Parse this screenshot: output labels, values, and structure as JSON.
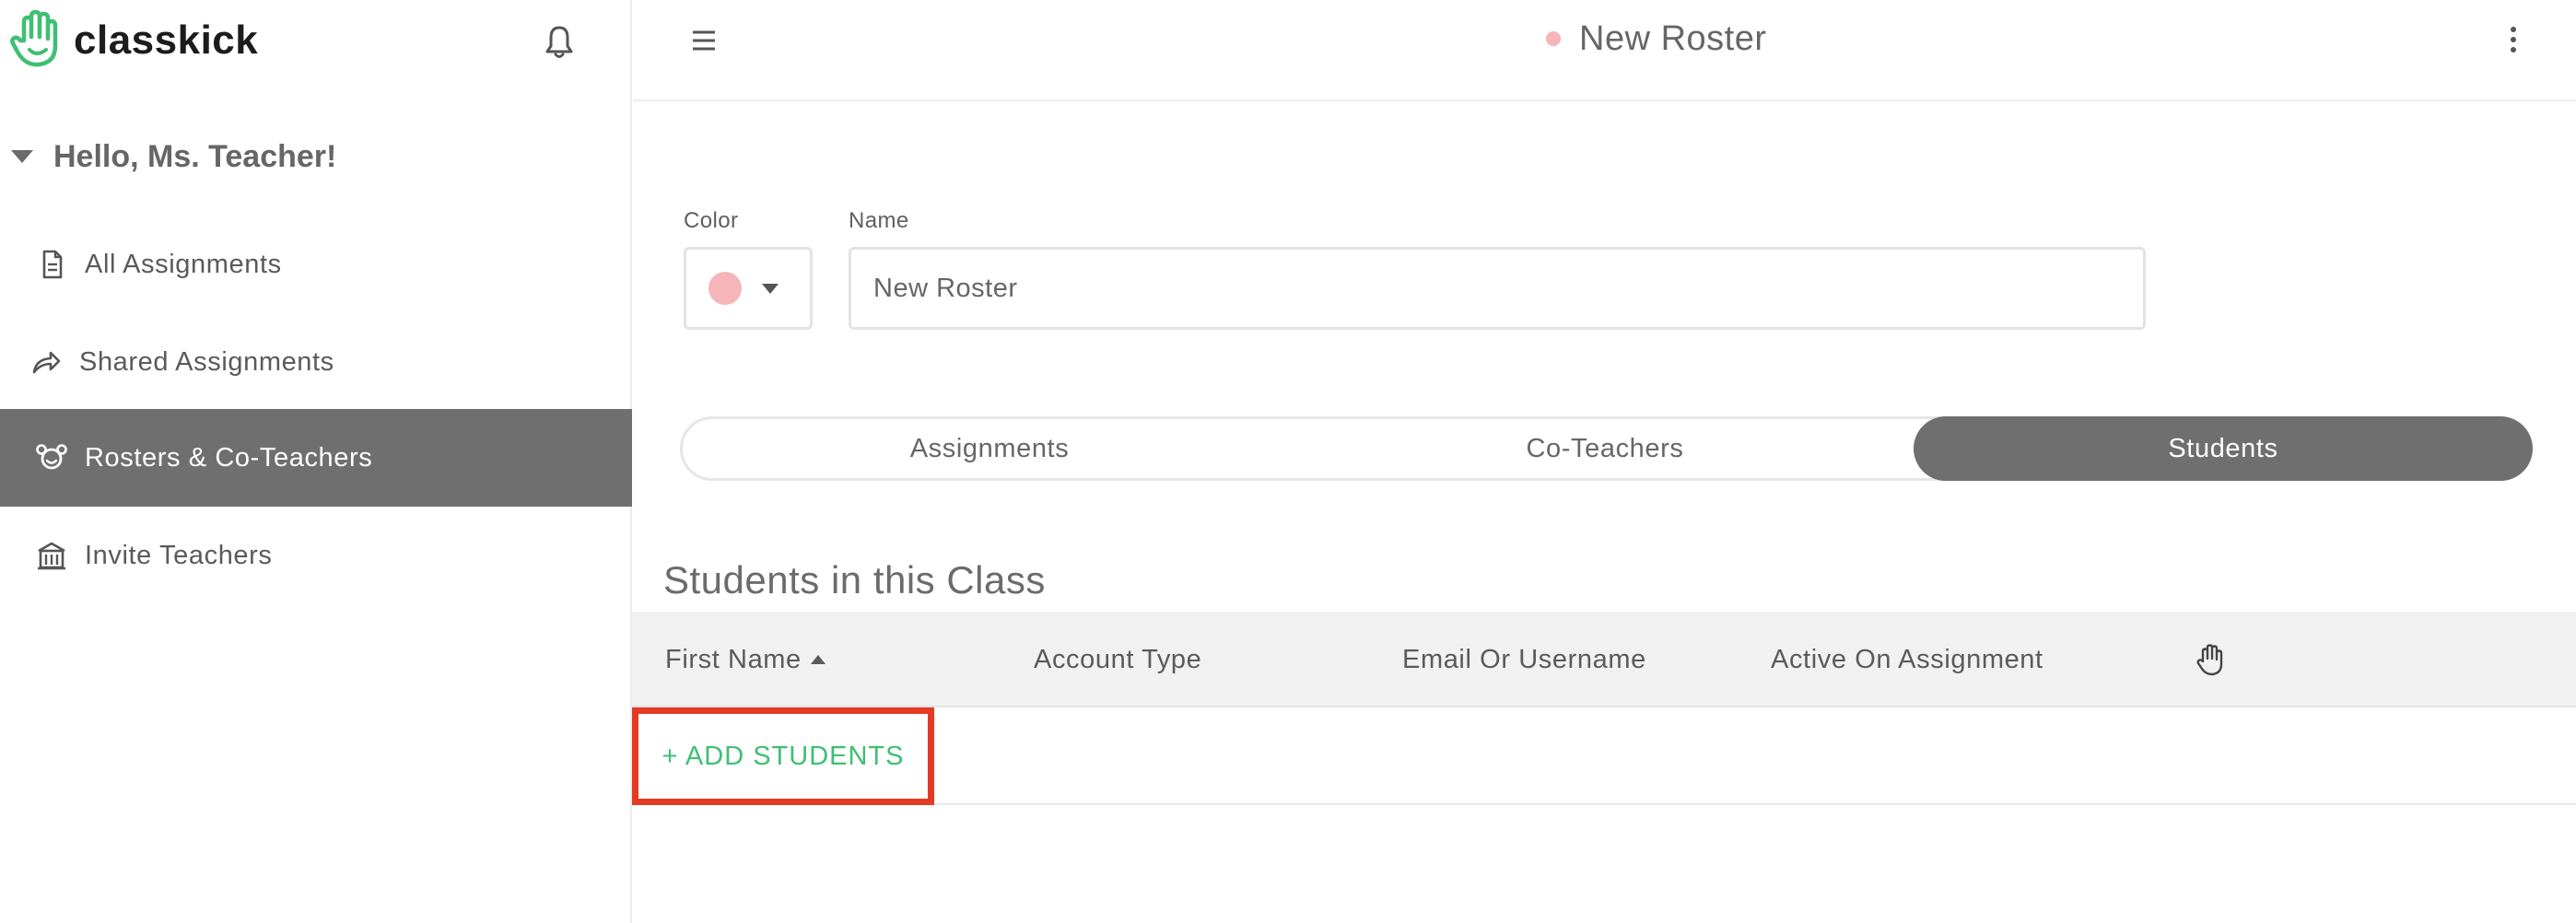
{
  "brand": {
    "name": "classkick"
  },
  "sidebar": {
    "greeting": "Hello, Ms. Teacher!",
    "items": [
      {
        "label": "All Assignments",
        "icon": "document-icon",
        "active": false
      },
      {
        "label": "Shared Assignments",
        "icon": "share-arrow-icon",
        "active": false
      },
      {
        "label": "Rosters & Co-Teachers",
        "icon": "roster-icon",
        "active": true
      },
      {
        "label": "Invite Teachers",
        "icon": "school-icon",
        "active": false
      }
    ]
  },
  "header": {
    "title": "New Roster",
    "title_dot_color": "#f5b5b9"
  },
  "form": {
    "color_label": "Color",
    "selected_color": "#f5b5b9",
    "name_label": "Name",
    "name_value": "New Roster"
  },
  "tabs": [
    {
      "label": "Assignments",
      "active": false
    },
    {
      "label": "Co-Teachers",
      "active": false
    },
    {
      "label": "Students",
      "active": true
    }
  ],
  "students": {
    "section_title": "Students in this Class",
    "columns": [
      "First Name",
      "Account Type",
      "Email Or Username",
      "Active On Assignment"
    ],
    "sort_column": "First Name",
    "sort_direction": "ascending",
    "hand_column_icon": "raised-hand-icon",
    "add_label": "+ ADD STUDENTS"
  },
  "colors": {
    "accent_green": "#3fbf73",
    "active_gray": "#6f6f70",
    "highlight_red": "#e53a24"
  }
}
